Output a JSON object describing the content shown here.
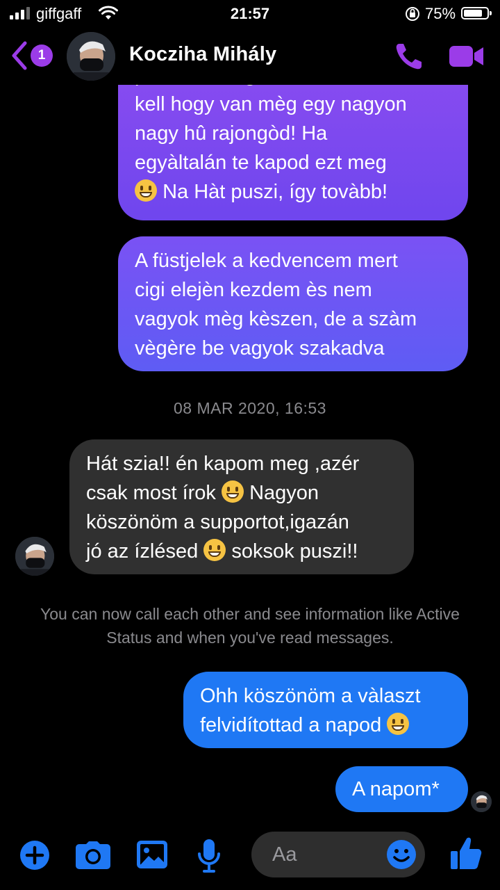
{
  "status_bar": {
    "carrier": "giffgaff",
    "time": "21:57",
    "battery": "75%",
    "battery_level": 0.75
  },
  "header": {
    "back_badge": "1",
    "contact_name": "Kocziha Mihály",
    "icons": [
      "back-chevron-icon",
      "phone-icon",
      "video-camera-icon"
    ]
  },
  "messages": [
    {
      "direction": "sent",
      "lines": [
        "párom csak gondoltam tudnod",
        "kell hogy van mèg egy nagyon",
        "nagy hû rajongòd! Ha",
        "egyàltalán te kapod ezt meg",
        "Na Hàt puszi, így tovàbb!"
      ]
    },
    {
      "direction": "sent",
      "lines": [
        "A füstjelek a kedvencem mert",
        "cigi elejèn kezdem ès nem",
        "vagyok mèg kèszen, de a szàm",
        "vègère be vagyok szakadva"
      ]
    },
    {
      "direction": "received",
      "lines": [
        "Hát szia!! én kapom meg ,azér",
        "csak most írok",
        "Nagyon",
        "köszönöm a supportot,igazán",
        "jó az ízlésed",
        "soksok puszi!!"
      ]
    },
    {
      "direction": "sent",
      "lines": [
        "Ohh köszönöm a vàlaszt",
        "felvidítottad a napod"
      ]
    },
    {
      "direction": "sent",
      "lines": [
        "A napom*"
      ]
    }
  ],
  "timestamp": "08 MAR 2020, 16:53",
  "system_note": "You can now call each other and see information like Active Status and when you've read messages.",
  "composer": {
    "placeholder": "Aa",
    "icons": [
      "plus-icon",
      "camera-icon",
      "gallery-icon",
      "microphone-icon",
      "emoji-icon",
      "thumbs-up-icon"
    ]
  },
  "colors": {
    "accent": "#1f78f4",
    "purple": "#8b4cf0",
    "received_bubble": "#303030"
  }
}
